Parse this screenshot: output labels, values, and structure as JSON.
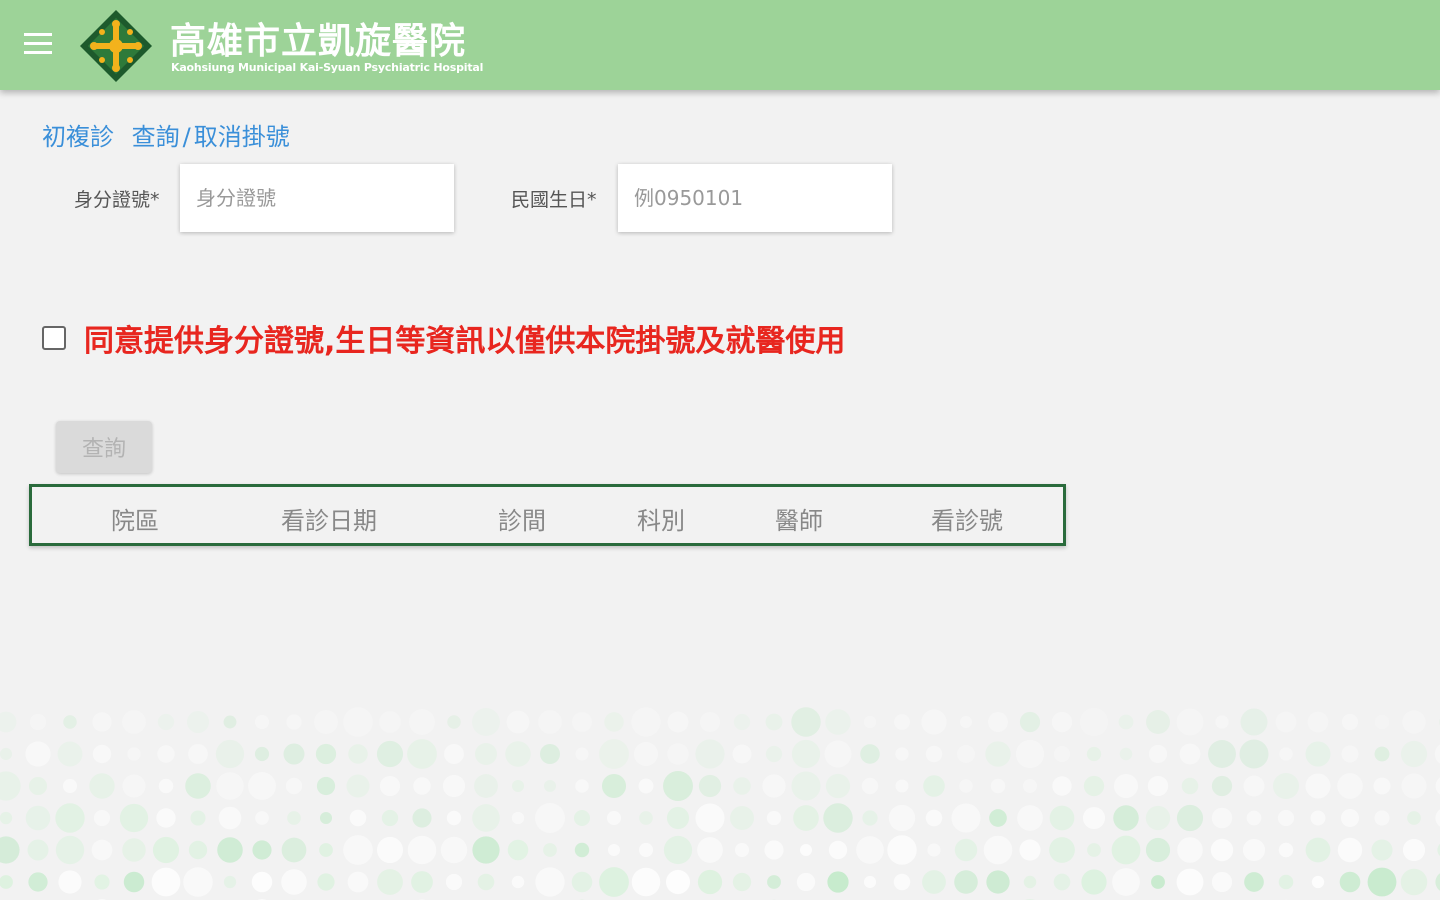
{
  "header": {
    "title_zh": "高雄市立凱旋醫院",
    "title_en": "Kaohsiung Municipal Kai-Syuan Psychiatric Hospital",
    "menu_icon": "hamburger-menu-icon",
    "logo_icon": "hospital-logo-icon"
  },
  "breadcrumb": {
    "part1": "初複診",
    "part2": "查詢",
    "separator": "/",
    "part3": "取消掛號"
  },
  "form": {
    "id_label": "身分證號*",
    "id_placeholder": "身分證號",
    "birthday_label": "民國生日*",
    "birthday_placeholder": "例0950101"
  },
  "consent": {
    "text": "同意提供身分證號,生日等資訊以僅供本院掛號及就醫使用",
    "checked": false
  },
  "query_button": "查詢",
  "table": {
    "headers": [
      "院區",
      "看診日期",
      "診間",
      "科別",
      "醫師",
      "看診號"
    ]
  },
  "colors": {
    "header_bg": "#9dd398",
    "breadcrumb": "#3a8fd9",
    "consent_text": "#e8261f",
    "table_border": "#2a6b3c"
  }
}
